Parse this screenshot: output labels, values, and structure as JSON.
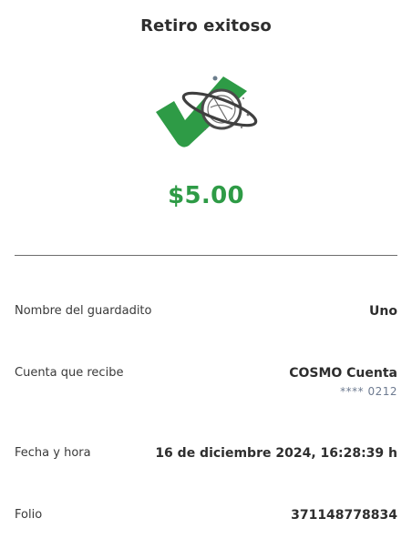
{
  "header": {
    "title": "Retiro exitoso"
  },
  "hero": {
    "icon": "check-planet-icon",
    "colors": {
      "check": "#2e9b46",
      "planet": "#4a4a4a"
    }
  },
  "amount": "$5.00",
  "colors": {
    "accent": "#2e9b46",
    "sub_text": "#6d7a90"
  },
  "details": {
    "name_label": "Nombre del guardadito",
    "name_value": "Uno",
    "account_label": "Cuenta que recibe",
    "account_value": "COSMO Cuenta",
    "account_number": "**** 0212",
    "date_label": "Fecha y hora",
    "date_value": "16 de diciembre 2024, 16:28:39 h",
    "folio_label": "Folio",
    "folio_value": "371148778834"
  }
}
